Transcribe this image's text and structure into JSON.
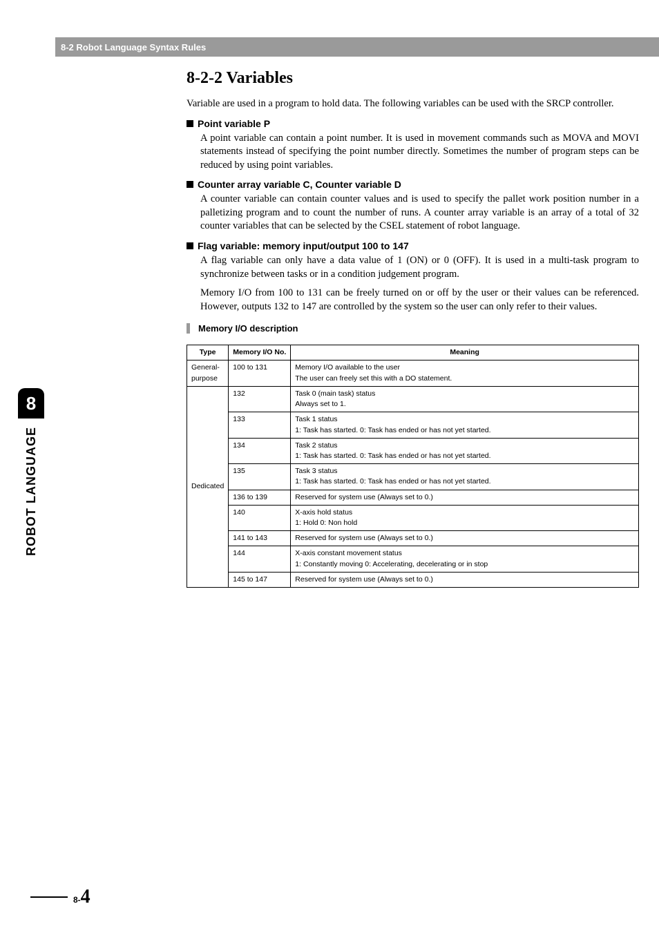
{
  "header": {
    "title": "8-2 Robot Language Syntax Rules"
  },
  "side_tab": {
    "chapter_number": "8",
    "label": "ROBOT LANGUAGE"
  },
  "footer": {
    "page_prefix": "8-",
    "page_number": "4"
  },
  "section": {
    "title": "8-2-2   Variables",
    "intro": "Variable are used in a program to hold data. The following variables can be used with the SRCP controller.",
    "sub1_heading": "Point variable P",
    "sub1_body": "A point variable can contain a point number. It is used in movement commands such as MOVA and MOVI statements instead of specifying the point number directly. Sometimes the number of program steps can be reduced by using point variables.",
    "sub2_heading": "Counter array variable C, Counter variable D",
    "sub2_body": "A counter variable can contain counter values and is used to specify the pallet work position number in a palletizing program and to count the number of runs. A counter array variable is an array of a total of 32 counter variables that can be selected by the CSEL statement of robot language.",
    "sub3_heading": "Flag variable: memory input/output 100 to 147",
    "sub3_body_p1": "A flag variable can only have a data value of 1 (ON) or 0 (OFF). It is used in a multi-task program to synchronize between tasks or in a condition judgement program.",
    "sub3_body_p2": "Memory I/O from 100 to 131 can be freely turned on or off by the user or their values can be referenced. However, outputs 132 to 147 are controlled by the system so the user can only refer to their values.",
    "mem_desc_title": "Memory I/O description"
  },
  "table": {
    "headers": {
      "type": "Type",
      "mem": "Memory I/O No.",
      "meaning": "Meaning"
    },
    "general_type": "General-purpose",
    "dedicated_type": "Dedicated",
    "general_row": {
      "mem": "100 to 131",
      "meaning": "Memory I/O available to the user\nThe user can freely set this with a DO statement."
    },
    "dedicated_rows": [
      {
        "mem": "132",
        "meaning": "Task 0 (main task) status\nAlways set to 1."
      },
      {
        "mem": "133",
        "meaning": "Task 1 status\n1: Task has started. 0: Task has ended or has not yet started."
      },
      {
        "mem": "134",
        "meaning": "Task 2 status\n1: Task has started. 0: Task has ended or has not yet started."
      },
      {
        "mem": "135",
        "meaning": "Task 3 status\n1: Task has started. 0: Task has ended or has not yet started."
      },
      {
        "mem": "136 to 139",
        "meaning": "Reserved for system use (Always set to 0.)"
      },
      {
        "mem": "140",
        "meaning": "X-axis hold status\n1: Hold 0: Non hold"
      },
      {
        "mem": "141 to 143",
        "meaning": "Reserved for system use (Always set to 0.)"
      },
      {
        "mem": "144",
        "meaning": "X-axis constant movement status\n1: Constantly moving 0: Accelerating, decelerating or in stop"
      },
      {
        "mem": "145 to 147",
        "meaning": "Reserved for system use (Always set to 0.)"
      }
    ]
  }
}
